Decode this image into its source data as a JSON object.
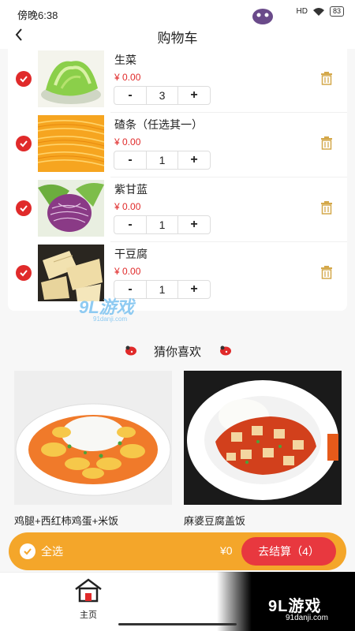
{
  "status_bar": {
    "time": "傍晚6:38",
    "signal": "HD",
    "battery": "83"
  },
  "nav": {
    "title": "购物车"
  },
  "cart": {
    "items": [
      {
        "name": "生菜",
        "price": "¥ 0.00",
        "qty": "3"
      },
      {
        "name": "碴条（任选其一）",
        "price": "¥ 0.00",
        "qty": "1"
      },
      {
        "name": "紫甘蓝",
        "price": "¥ 0.00",
        "qty": "1"
      },
      {
        "name": "干豆腐",
        "price": "¥ 0.00",
        "qty": "1"
      }
    ],
    "minus_label": "-",
    "plus_label": "+"
  },
  "recommend": {
    "title": "猜你喜欢",
    "items": [
      {
        "name": "鸡腿+西红柿鸡蛋+米饭"
      },
      {
        "name": "麻婆豆腐盖饭"
      }
    ]
  },
  "checkout": {
    "select_all": "全选",
    "total": "¥0",
    "button": "去结算（4）"
  },
  "tabbar": {
    "home": "主页"
  },
  "watermark": {
    "logo": "9L游戏",
    "site": "91danji.com"
  },
  "colors": {
    "accent_red": "#e02a2a",
    "checkout_bar": "#f4a62a",
    "checkout_button": "#e8383f",
    "trash_gold": "#d4a84a"
  }
}
